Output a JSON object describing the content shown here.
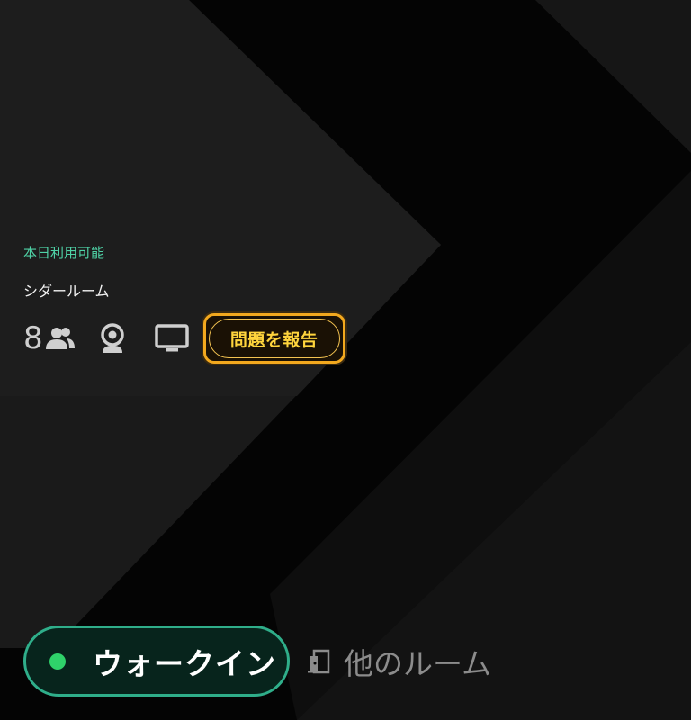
{
  "room": {
    "status": "本日利用可能",
    "name": "シダールーム",
    "capacity": "8"
  },
  "amenities": {
    "icons": [
      "people-icon",
      "webcam-icon",
      "tv-icon"
    ]
  },
  "report_button": {
    "label": "問題を報告"
  },
  "walkin_button": {
    "label": "ウォークイン",
    "status_color": "#2fd26a"
  },
  "other_rooms": {
    "label": "他のルーム",
    "icon": "door-icon"
  },
  "colors": {
    "status_text": "#4fd2a6",
    "report_accent": "#ffd53d",
    "report_border": "#f2a81e",
    "walkin_border": "#2fae8a",
    "background": "#040404"
  }
}
